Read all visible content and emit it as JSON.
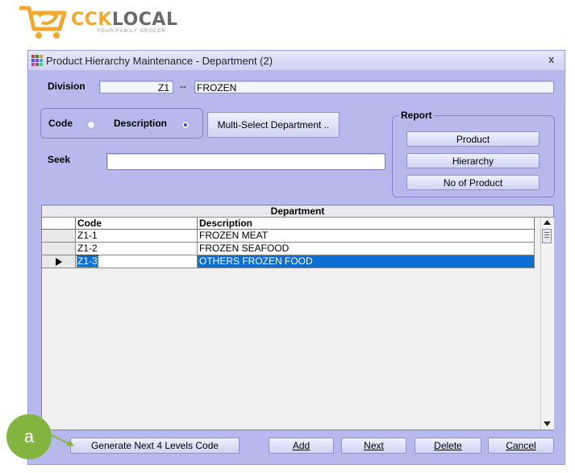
{
  "logo": {
    "brand_cck": "CCK",
    "brand_local": "LOCAL",
    "tagline": "YOUR FAMILY GROCER"
  },
  "window": {
    "title": "Product Hierarchy Maintenance - Department (2)",
    "close_glyph": "x"
  },
  "division": {
    "label": "Division",
    "code": "Z1",
    "separator": "--",
    "name": "FROZEN"
  },
  "search_mode": {
    "code_label": "Code",
    "description_label": "Description",
    "selected": "description"
  },
  "multi_select_button": "Multi-Select Department ..",
  "seek": {
    "label": "Seek",
    "value": ""
  },
  "report": {
    "title": "Report",
    "product": "Product",
    "hierarchy": "Hierarchy",
    "no_of_product": "No of Product"
  },
  "grid": {
    "caption": "Department",
    "columns": [
      "Code",
      "Description"
    ],
    "rows": [
      {
        "code": "Z1-1",
        "description": "FROZEN MEAT"
      },
      {
        "code": "Z1-2",
        "description": "FROZEN SEAFOOD"
      },
      {
        "code": "Z1-3",
        "description": "OTHERS FROZEN FOOD"
      }
    ],
    "selected_row": 2
  },
  "footer": {
    "generate": "Generate Next 4 Levels Code",
    "add": "Add",
    "next": "Next",
    "delete": "Delete",
    "cancel": "Cancel"
  },
  "annotation": {
    "badge": "a",
    "color": "#82b43f"
  }
}
